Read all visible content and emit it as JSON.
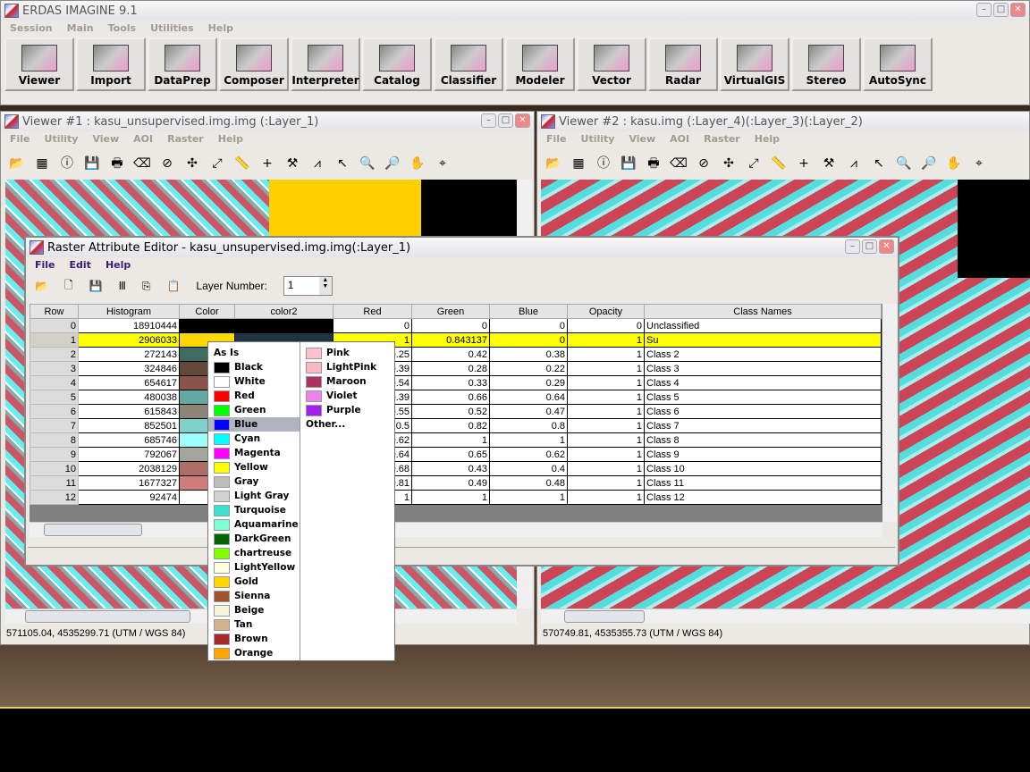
{
  "app": {
    "title": "ERDAS IMAGINE 9.1",
    "menu": [
      "Session",
      "Main",
      "Tools",
      "Utilities",
      "Help"
    ],
    "buttons": [
      "Viewer",
      "Import",
      "DataPrep",
      "Composer",
      "Interpreter",
      "Catalog",
      "Classifier",
      "Modeler",
      "Vector",
      "Radar",
      "VirtualGIS",
      "Stereo",
      "AutoSync"
    ]
  },
  "viewer1": {
    "title": "Viewer #1 : kasu_unsupervised.img.img (:Layer_1)",
    "menu": [
      "File",
      "Utility",
      "View",
      "AOI",
      "Raster",
      "Help"
    ],
    "status": "571105.04, 4535299.71   (UTM / WGS 84)"
  },
  "viewer2": {
    "title": "Viewer #2 : kasu.img (:Layer_4)(:Layer_3)(:Layer_2)",
    "menu": [
      "File",
      "Utility",
      "View",
      "AOI",
      "Raster",
      "Help"
    ],
    "status": "570749.81, 4535355.73   (UTM / WGS 84)"
  },
  "rae": {
    "title": "Raster Attribute Editor - kasu_unsupervised.img.img(:Layer_1)",
    "menu": [
      "File",
      "Edit",
      "Help"
    ],
    "layer_label": "Layer Number:",
    "layer_value": "1",
    "columns": [
      "Row",
      "Histogram",
      "Color",
      "color2",
      "Red",
      "Green",
      "Blue",
      "Opacity",
      "Class Names"
    ],
    "rows": [
      {
        "row": "0",
        "hist": "18910444",
        "color": "#000000",
        "color2": "#000000",
        "red": "0",
        "green": "0",
        "blue": "0",
        "opacity": "0",
        "name": "Unclassified"
      },
      {
        "row": "1",
        "hist": "2906033",
        "color": "#ffd700",
        "color2": "#1f3340",
        "red": "1",
        "green": "0.843137",
        "blue": "0",
        "opacity": "1",
        "name": "Su",
        "selected": true
      },
      {
        "row": "2",
        "hist": "272143",
        "color": "#406b61",
        "red": "0.25",
        "green": "0.42",
        "blue": "0.38",
        "opacity": "1",
        "name": "Class 2"
      },
      {
        "row": "3",
        "hist": "324846",
        "color": "#634738",
        "red": "0.39",
        "green": "0.28",
        "blue": "0.22",
        "opacity": "1",
        "name": "Class 3"
      },
      {
        "row": "4",
        "hist": "654617",
        "color": "#8a544a",
        "red": "0.54",
        "green": "0.33",
        "blue": "0.29",
        "opacity": "1",
        "name": "Class 4"
      },
      {
        "row": "5",
        "hist": "480038",
        "color": "#63a8a3",
        "red": "0.39",
        "green": "0.66",
        "blue": "0.64",
        "opacity": "1",
        "name": "Class 5"
      },
      {
        "row": "6",
        "hist": "615843",
        "color": "#8c8578",
        "red": "0.55",
        "green": "0.52",
        "blue": "0.47",
        "opacity": "1",
        "name": "Class 6"
      },
      {
        "row": "7",
        "hist": "852501",
        "color": "#80d1cc",
        "red": "0.5",
        "green": "0.82",
        "blue": "0.8",
        "opacity": "1",
        "name": "Class 7"
      },
      {
        "row": "8",
        "hist": "685746",
        "color": "#9effff",
        "red": "0.62",
        "green": "1",
        "blue": "1",
        "opacity": "1",
        "name": "Class 8"
      },
      {
        "row": "9",
        "hist": "792067",
        "color": "#a3a69e",
        "red": "0.64",
        "green": "0.65",
        "blue": "0.62",
        "opacity": "1",
        "name": "Class 9"
      },
      {
        "row": "10",
        "hist": "2038129",
        "color": "#ad6e66",
        "red": "0.68",
        "green": "0.43",
        "blue": "0.4",
        "opacity": "1",
        "name": "Class 10"
      },
      {
        "row": "11",
        "hist": "1677327",
        "color": "#cf7d7a",
        "red": "0.81",
        "green": "0.49",
        "blue": "0.48",
        "opacity": "1",
        "name": "Class 11"
      },
      {
        "row": "12",
        "hist": "92474",
        "color": "#ffffff",
        "red": "1",
        "green": "1",
        "blue": "1",
        "opacity": "1",
        "name": "Class 12"
      }
    ]
  },
  "color_menu": {
    "first": "As Is",
    "highlighted": "Blue",
    "left": [
      {
        "label": "Black",
        "color": "#000000"
      },
      {
        "label": "White",
        "color": "#ffffff"
      },
      {
        "label": "Red",
        "color": "#ff0000"
      },
      {
        "label": "Green",
        "color": "#00ff00"
      },
      {
        "label": "Blue",
        "color": "#0000ff"
      },
      {
        "label": "Cyan",
        "color": "#00ffff"
      },
      {
        "label": "Magenta",
        "color": "#ff00ff"
      },
      {
        "label": "Yellow",
        "color": "#ffff00"
      },
      {
        "label": "Gray",
        "color": "#bebebe"
      },
      {
        "label": "Light Gray",
        "color": "#d3d3d3"
      },
      {
        "label": "Turquoise",
        "color": "#40e0d0"
      },
      {
        "label": "Aquamarine",
        "color": "#7fffd4"
      },
      {
        "label": "DarkGreen",
        "color": "#006400"
      },
      {
        "label": "chartreuse",
        "color": "#7fff00"
      },
      {
        "label": "LightYellow",
        "color": "#ffffe0"
      },
      {
        "label": "Gold",
        "color": "#ffd700"
      },
      {
        "label": "Sienna",
        "color": "#a0522d"
      },
      {
        "label": "Beige",
        "color": "#f5f5dc"
      },
      {
        "label": "Tan",
        "color": "#d2b48c"
      },
      {
        "label": "Brown",
        "color": "#a52a2a"
      },
      {
        "label": "Orange",
        "color": "#ffa500"
      }
    ],
    "right": [
      {
        "label": "Pink",
        "color": "#ffc0cb"
      },
      {
        "label": "LightPink",
        "color": "#ffb6c1"
      },
      {
        "label": "Maroon",
        "color": "#b03060"
      },
      {
        "label": "Violet",
        "color": "#ee82ee"
      },
      {
        "label": "Purple",
        "color": "#a020f0"
      }
    ],
    "other": "Other..."
  }
}
